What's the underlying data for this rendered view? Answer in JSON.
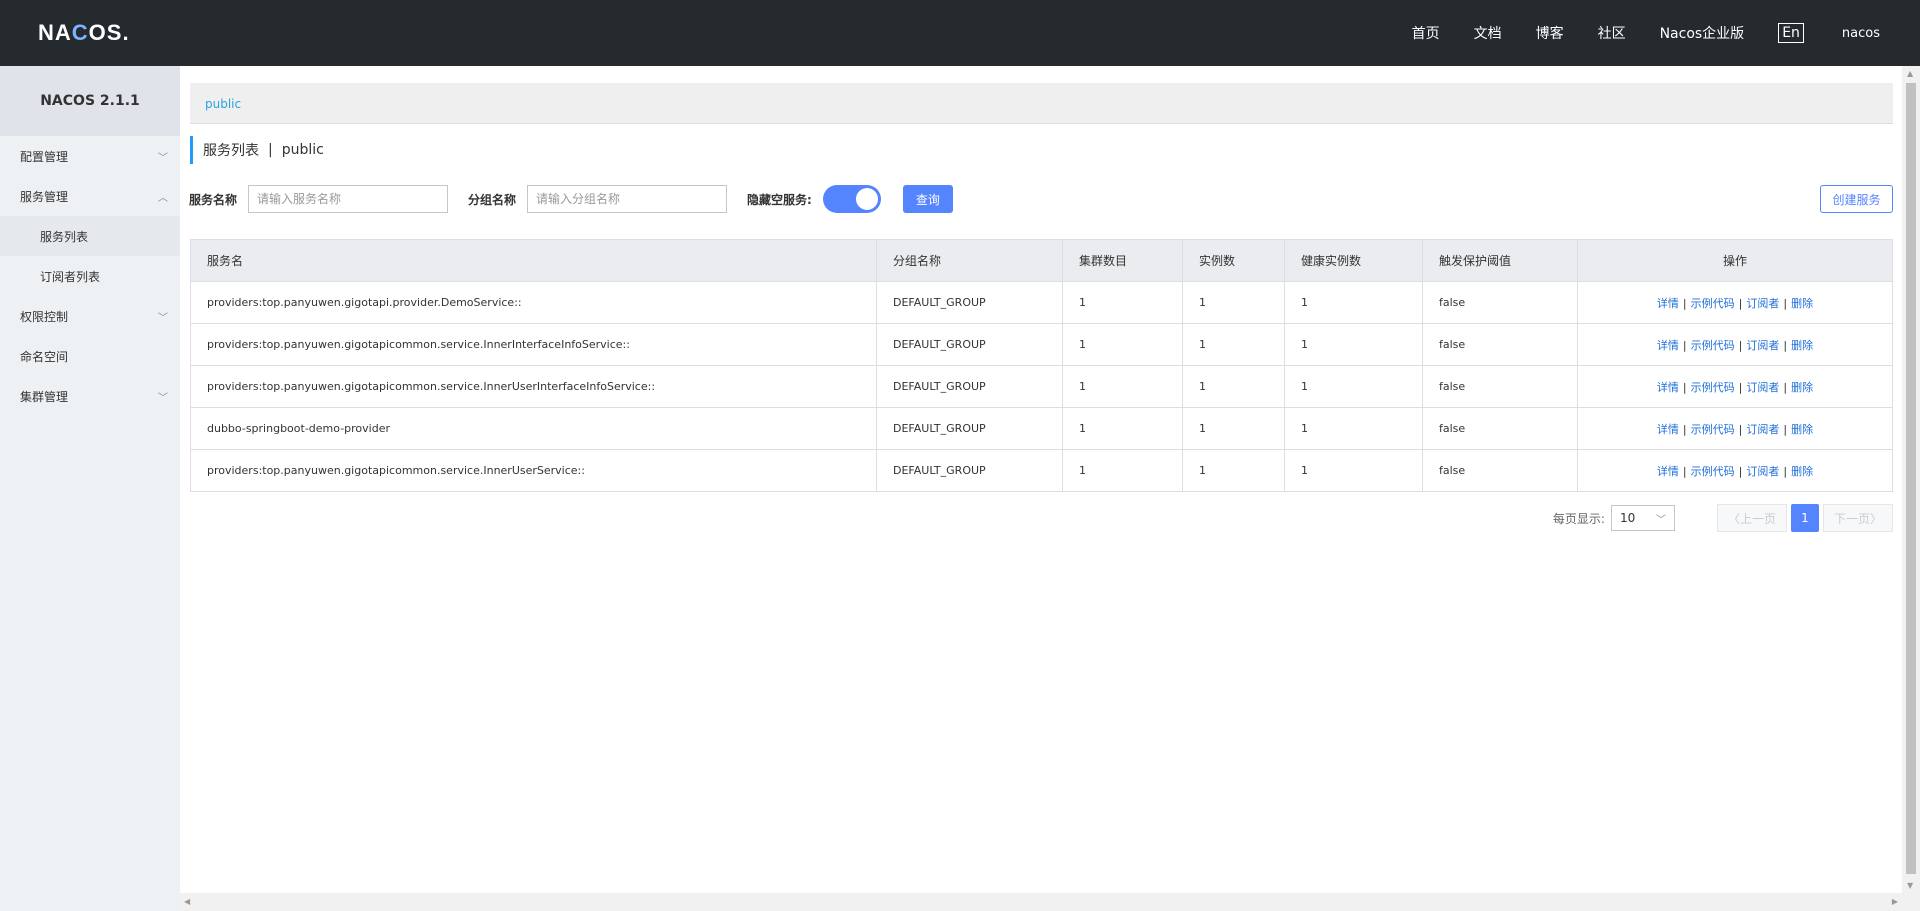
{
  "header": {
    "logo_text_1": "NA",
    "logo_text_2": "C",
    "logo_text_3": "OS.",
    "nav": [
      "首页",
      "文档",
      "博客",
      "社区",
      "Nacos企业版"
    ],
    "lang": "En",
    "user": "nacos"
  },
  "sidebar": {
    "title": "NACOS 2.1.1",
    "items": [
      {
        "label": "配置管理",
        "expanded": false
      },
      {
        "label": "服务管理",
        "expanded": true
      },
      {
        "label": "服务列表",
        "sub": true,
        "active": true
      },
      {
        "label": "订阅者列表",
        "sub": true
      },
      {
        "label": "权限控制",
        "expanded": false
      },
      {
        "label": "命名空间"
      },
      {
        "label": "集群管理",
        "expanded": false
      }
    ]
  },
  "namespace": {
    "current": "public"
  },
  "page": {
    "title": "服务列表",
    "sep": "|",
    "namespace": "public"
  },
  "filters": {
    "service_name_label": "服务名称",
    "service_name_placeholder": "请输入服务名称",
    "group_name_label": "分组名称",
    "group_name_placeholder": "请输入分组名称",
    "hide_empty_label": "隐藏空服务:",
    "hide_empty_on": true,
    "query_button": "查询",
    "create_button": "创建服务"
  },
  "table": {
    "columns": [
      "服务名",
      "分组名称",
      "集群数目",
      "实例数",
      "健康实例数",
      "触发保护阈值",
      "操作"
    ],
    "rows": [
      [
        "providers:top.panyuwen.gigotapi.provider.DemoService::",
        "DEFAULT_GROUP",
        "1",
        "1",
        "1",
        "false"
      ],
      [
        "providers:top.panyuwen.gigotapicommon.service.InnerInterfaceInfoService::",
        "DEFAULT_GROUP",
        "1",
        "1",
        "1",
        "false"
      ],
      [
        "providers:top.panyuwen.gigotapicommon.service.InnerUserInterfaceInfoService::",
        "DEFAULT_GROUP",
        "1",
        "1",
        "1",
        "false"
      ],
      [
        "dubbo-springboot-demo-provider",
        "DEFAULT_GROUP",
        "1",
        "1",
        "1",
        "false"
      ],
      [
        "providers:top.panyuwen.gigotapicommon.service.InnerUserService::",
        "DEFAULT_GROUP",
        "1",
        "1",
        "1",
        "false"
      ]
    ],
    "ops": [
      "详情",
      "示例代码",
      "订阅者",
      "删除"
    ],
    "op_sep": "|"
  },
  "pagination": {
    "per_page_label": "每页显示:",
    "per_page": "10",
    "prev": "上一页",
    "next": "下一页",
    "current": "1"
  }
}
